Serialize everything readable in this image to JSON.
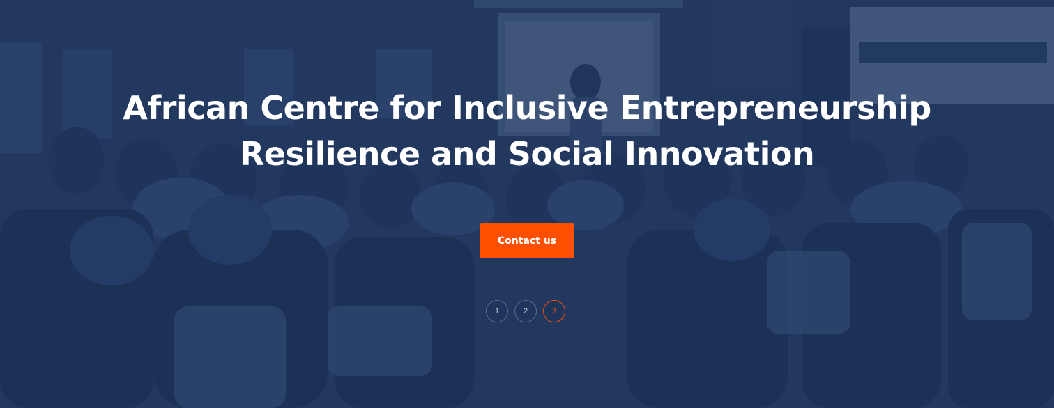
{
  "hero": {
    "title_line1": "African Centre for Inclusive Entrepreneurship",
    "title_line2": "Resilience and Social Innovation",
    "cta_label": "Contact us",
    "accent_color": "#fe5000",
    "overlay_color": "#1c3158",
    "background_image": "seminar-audience-photo"
  },
  "pager": {
    "slides": [
      "1",
      "2",
      "3"
    ],
    "active_index": 2
  }
}
